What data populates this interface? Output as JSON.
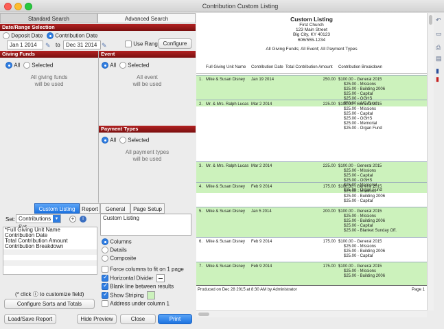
{
  "window": {
    "title": "Contribution Custom Listing"
  },
  "tabs_top": [
    "Standard Search",
    "Advanced Search"
  ],
  "date_range": {
    "header": "Date/Range Selection",
    "deposit_label": "Deposit Date",
    "contribution_label": "Contribution Date",
    "from": "Jan 1 2014",
    "to_label": "to",
    "to": "Dec 31 2014",
    "use_ranges_label": "Use Ranges",
    "configure_label": "Configure"
  },
  "giving_funds": {
    "header": "Giving Funds",
    "all": "All",
    "selected": "Selected",
    "note": "All giving funds\nwill be used"
  },
  "event": {
    "header": "Event",
    "all": "All",
    "selected": "Selected",
    "note": "All event\nwill be used"
  },
  "payment_types": {
    "header": "Payment Types",
    "all": "All",
    "selected": "Selected",
    "note": "All payment types\nwill be used"
  },
  "bottom_tabs": [
    "Custom Listing",
    "Report",
    "General",
    "Page Setup"
  ],
  "set": {
    "label": "Set:",
    "value": "Contributions Set"
  },
  "fields_list": [
    "*Full Giving Unit Name",
    "Contribution Date",
    "Total Contribution Amount",
    "Contribution Breakdown"
  ],
  "title_field": "Custom Listing",
  "format_options": {
    "columns": "Columns",
    "details": "Details",
    "composite": "Composite"
  },
  "options": {
    "force_columns": "Force columns to fit on 1 page",
    "horizontal_divider": "Horizontal Divider",
    "blank_line": "Blank line between results",
    "show_striping": "Show Striping",
    "address_under": "Address under column 1"
  },
  "customize_hint": "(* click ⓘ to customize field)",
  "configure_sorts": "Configure Sorts and Totals",
  "buttons": {
    "load_save": "Load/Save Report",
    "hide_preview": "Hide Preview",
    "close": "Close",
    "print": "Print"
  },
  "report": {
    "title": "Custom Listing",
    "org": "First Church",
    "address": "123 Main Street",
    "city": "Big City, KY  40123",
    "phone": "606/555-1234",
    "filter": "All Giving Funds; All Event; All Payment Types",
    "columns": [
      "Full Giving Unit Name",
      "Contribution Date",
      "Total Contribution Amount",
      "Contribution Breakdown"
    ],
    "records": [
      {
        "num": "1.",
        "name": "Mike & Susan Disney",
        "date": "Jan 19 2014",
        "amount": "250.00",
        "breakdown": [
          "$100.00 - General 2015",
          "$25.00 - Missions",
          "$25.00 - Building 2006",
          "$25.00 - Capital",
          "$25.00 - OGHS",
          "$50.00 - A/C Fund"
        ]
      },
      {
        "num": "2.",
        "name": "Mr. & Mrs. Ralph Lucas",
        "date": "Mar 2 2014",
        "amount": "225.00",
        "breakdown": [
          "$100.00 - General 2015",
          "$25.00 - Missions",
          "$25.00 - Capital",
          "$25.00 - OGHS",
          "$25.00 - Memorial",
          "$25.00 - Organ Fund"
        ]
      },
      {
        "num": "3.",
        "name": "Mr. & Mrs. Ralph Lucas",
        "date": "Mar 2 2014",
        "amount": "225.00",
        "breakdown": [
          "$100.00 - General 2015",
          "$25.00 - Missions",
          "$25.00 - Capital",
          "$25.00 - OGHS",
          "$25.00 - Memorial",
          "$25.00 - Organ Fund"
        ]
      },
      {
        "num": "4.",
        "name": "Mike & Susan Disney",
        "date": "Feb 9 2014",
        "amount": "175.00",
        "breakdown": [
          "$100.00 - General 2015",
          "$25.00 - Missions",
          "$25.00 - Building 2006",
          "$25.00 - Capital"
        ]
      },
      {
        "num": "5.",
        "name": "Mike & Susan Disney",
        "date": "Jan 5 2014",
        "amount": "200.00",
        "breakdown": [
          "$100.00 - General 2015",
          "$25.00 - Missions",
          "$25.00 - Building 2006",
          "$25.00 - Capital",
          "$25.00 - Blanket Sunday Off."
        ]
      },
      {
        "num": "6.",
        "name": "Mike & Susan Disney",
        "date": "Feb 9 2014",
        "amount": "175.00",
        "breakdown": [
          "$100.00 - General 2015",
          "$25.00 - Missions",
          "$25.00 - Building 2006",
          "$25.00 - Capital"
        ]
      },
      {
        "num": "7.",
        "name": "Mike & Susan Disney",
        "date": "Feb 9 2014",
        "amount": "175.00",
        "breakdown": [
          "$100.00 - General 2015",
          "$25.00 - Missions",
          "$25.00 - Building 2006"
        ]
      }
    ],
    "footer_left": "Produced on Dec 28 2015 at 8:30 AM by Administrator",
    "footer_right": "Page 1"
  },
  "colors": {
    "header_red": "#9e1b1b",
    "accent_blue": "#1d73e0",
    "stripe_green": "#ccf2bc"
  }
}
